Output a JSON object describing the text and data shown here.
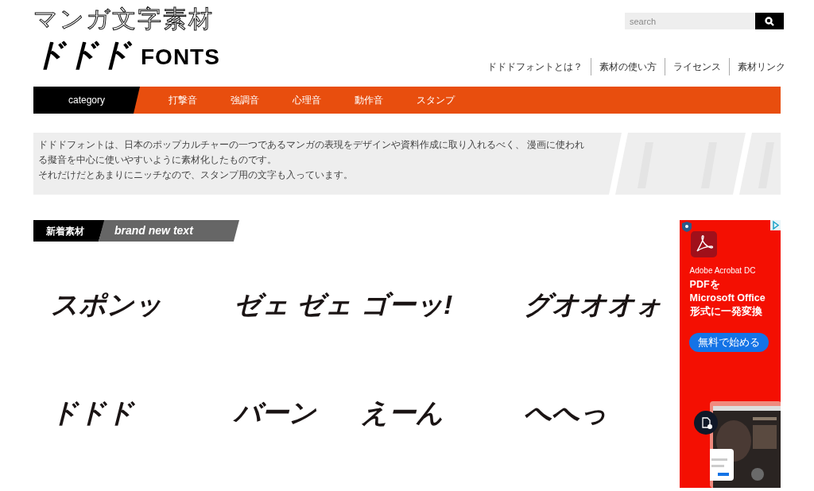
{
  "logo": {
    "line_1": "マンガ文字素材",
    "line_2_kana": "ドドド",
    "line_2_latin": "FONTS"
  },
  "search": {
    "placeholder": "search"
  },
  "header_links": [
    "ドドドフォントとは？",
    "素材の使い方",
    "ライセンス",
    "素材リンク"
  ],
  "category_bar": {
    "label": "category",
    "items": [
      "打撃音",
      "強調音",
      "心理音",
      "動作音",
      "スタンプ"
    ]
  },
  "intro": {
    "lines": [
      "ドドドフォントは、日本のポップカルチャーの一つであるマンガの表現をデザインや資料作成に取り入れるべく、 漫画に使われる擬音を中心に使いやすいように素材化したものです。",
      "それだけだとあまりにニッチなので、スタンプ用の文字も入っています。"
    ]
  },
  "new_section": {
    "title": "新着素材",
    "subtitle": "brand new text"
  },
  "materials": [
    "スポンッ",
    "ゼェ ゼェ",
    "ゴーッ!",
    "グオオオォ",
    "ドドド",
    "バーン",
    "えーん",
    "へへっ"
  ],
  "ad": {
    "product": "Adobe Acrobat DC",
    "headline": [
      "PDFを",
      "Microsoft Office",
      "形式に一発変換"
    ],
    "button": "無料で始める"
  }
}
